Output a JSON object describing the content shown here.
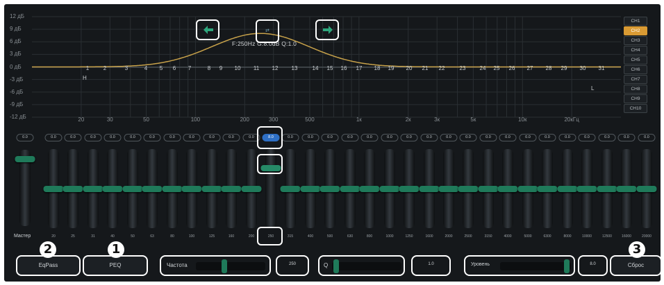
{
  "graph": {
    "y_ticks": [
      "12 дБ",
      "9 дБ",
      "6 дБ",
      "3 дБ",
      "0 дБ",
      "-3 дБ",
      "-6 дБ",
      "-9 дБ",
      "-12 дБ"
    ],
    "x_ticks": [
      "20",
      "30",
      "50",
      "100",
      "200",
      "300",
      "500",
      "1к",
      "2к",
      "3к",
      "5к",
      "10к",
      "20кГц"
    ],
    "band_numbers": [
      "1",
      "2",
      "3",
      "4",
      "5",
      "6",
      "7",
      "8",
      "9",
      "10",
      "11",
      "12",
      "13",
      "14",
      "15",
      "16",
      "17",
      "18",
      "19",
      "20",
      "21",
      "22",
      "23",
      "24",
      "25",
      "26",
      "27",
      "28",
      "29",
      "30",
      "31"
    ],
    "h_mark": "H",
    "l_mark": "L",
    "readout": "F:250Hz G:8.0dB Q:1.0",
    "curve_color": "#c8a24a",
    "left_arrow": "arrow-left-icon",
    "right_arrow": "arrow-right-icon"
  },
  "channels": [
    "CH1",
    "CH2",
    "CH3",
    "CH4",
    "CH5",
    "CH6",
    "CH7",
    "CH8",
    "CH9",
    "CH10"
  ],
  "active_channel": "CH2",
  "master": {
    "label": "Мастер",
    "value": "0.0",
    "level_db": 0
  },
  "bands": [
    {
      "freq": "20",
      "value": "0.0",
      "gain_db": 0
    },
    {
      "freq": "25",
      "value": "0.0",
      "gain_db": 0
    },
    {
      "freq": "31",
      "value": "0.0",
      "gain_db": 0
    },
    {
      "freq": "40",
      "value": "0.0",
      "gain_db": 0
    },
    {
      "freq": "50",
      "value": "0.0",
      "gain_db": 0
    },
    {
      "freq": "63",
      "value": "0.0",
      "gain_db": 0
    },
    {
      "freq": "80",
      "value": "0.0",
      "gain_db": 0
    },
    {
      "freq": "100",
      "value": "0.0",
      "gain_db": 0
    },
    {
      "freq": "125",
      "value": "0.0",
      "gain_db": 0
    },
    {
      "freq": "160",
      "value": "0.0",
      "gain_db": 0
    },
    {
      "freq": "200",
      "value": "0.0",
      "gain_db": 0
    },
    {
      "freq": "250",
      "value": "8.0",
      "gain_db": 8
    },
    {
      "freq": "315",
      "value": "0.0",
      "gain_db": 0
    },
    {
      "freq": "400",
      "value": "0.0",
      "gain_db": 0
    },
    {
      "freq": "500",
      "value": "0.0",
      "gain_db": 0
    },
    {
      "freq": "630",
      "value": "0.0",
      "gain_db": 0
    },
    {
      "freq": "800",
      "value": "0.0",
      "gain_db": 0
    },
    {
      "freq": "1000",
      "value": "0.0",
      "gain_db": 0
    },
    {
      "freq": "1250",
      "value": "0.0",
      "gain_db": 0
    },
    {
      "freq": "1600",
      "value": "0.0",
      "gain_db": 0
    },
    {
      "freq": "2000",
      "value": "0.0",
      "gain_db": 0
    },
    {
      "freq": "2500",
      "value": "0.0",
      "gain_db": 0
    },
    {
      "freq": "3150",
      "value": "0.0",
      "gain_db": 0
    },
    {
      "freq": "4000",
      "value": "0.0",
      "gain_db": 0
    },
    {
      "freq": "5000",
      "value": "0.0",
      "gain_db": 0
    },
    {
      "freq": "6300",
      "value": "0.0",
      "gain_db": 0
    },
    {
      "freq": "8000",
      "value": "0.0",
      "gain_db": 0
    },
    {
      "freq": "10000",
      "value": "0.0",
      "gain_db": 0
    },
    {
      "freq": "12500",
      "value": "0.0",
      "gain_db": 0
    },
    {
      "freq": "16000",
      "value": "0.0",
      "gain_db": 0
    },
    {
      "freq": "20000",
      "value": "0.0",
      "gain_db": 0
    }
  ],
  "bottom": {
    "eq_pass_label": "EqPass",
    "peq_label": "PEQ",
    "freq_label": "Частота",
    "freq_value": "250",
    "q_label": "Q",
    "q_value": "1.0",
    "level_label": "Уровень",
    "level_value": "8.0",
    "reset_label": "Сброс"
  },
  "badges": [
    "2",
    "1",
    "3"
  ],
  "colors": {
    "accent": "#1f7a5a",
    "active_channel": "#d99a33",
    "selected_value": "#2e6fc4"
  }
}
